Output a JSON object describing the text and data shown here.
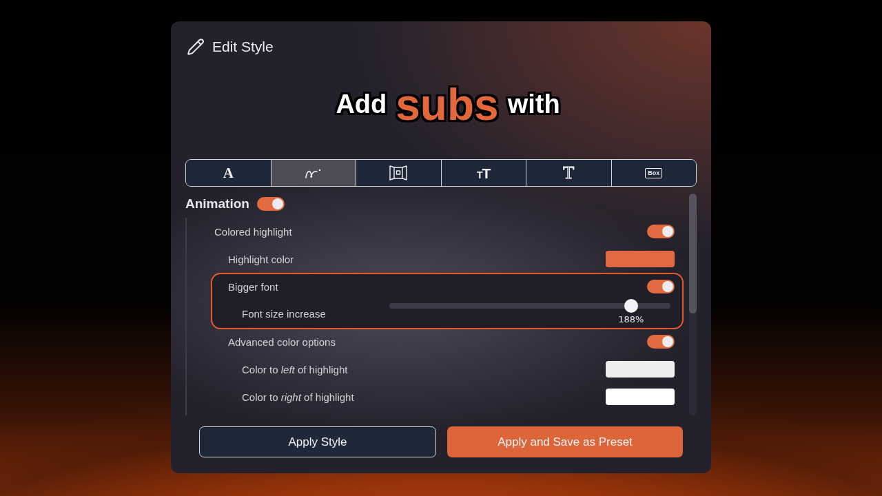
{
  "dialog": {
    "title": "Edit Style"
  },
  "preview": {
    "words": [
      {
        "text": "Add",
        "highlighted": false
      },
      {
        "text": "subs",
        "highlighted": true
      },
      {
        "text": "with",
        "highlighted": false
      }
    ]
  },
  "tabs": [
    {
      "kind": "letter",
      "glyph": "A",
      "selected": false
    },
    {
      "kind": "curve",
      "selected": true
    },
    {
      "kind": "frame",
      "selected": false
    },
    {
      "kind": "size",
      "glyph": "TT",
      "selected": false
    },
    {
      "kind": "outline",
      "glyph": "T",
      "selected": false
    },
    {
      "kind": "box",
      "glyph": "Box",
      "selected": false
    }
  ],
  "section": {
    "title": "Animation",
    "on": true,
    "settings": [
      {
        "kind": "toggle",
        "label": "Colored highlight",
        "on": true,
        "children": [
          {
            "kind": "color",
            "label": "Highlight color",
            "color": "#e26a40"
          },
          {
            "kind": "toggle",
            "label": "Bigger font",
            "on": true,
            "highlighted": true,
            "children": [
              {
                "kind": "slider",
                "label": "Font size increase",
                "level": 0.86,
                "reading": "188%"
              }
            ]
          },
          {
            "kind": "toggle",
            "label": "Advanced color options",
            "on": true,
            "children": [
              {
                "kind": "color",
                "label": "Color to *left* of highlight",
                "color": "#eeeeee"
              },
              {
                "kind": "color",
                "label": "Color to *right* of highlight",
                "color": "#ffffff"
              }
            ]
          }
        ]
      }
    ]
  },
  "buttons": [
    {
      "label": "Apply Style",
      "kind": "secondary"
    },
    {
      "label": "Apply and Save as Preset",
      "kind": "primary"
    }
  ]
}
